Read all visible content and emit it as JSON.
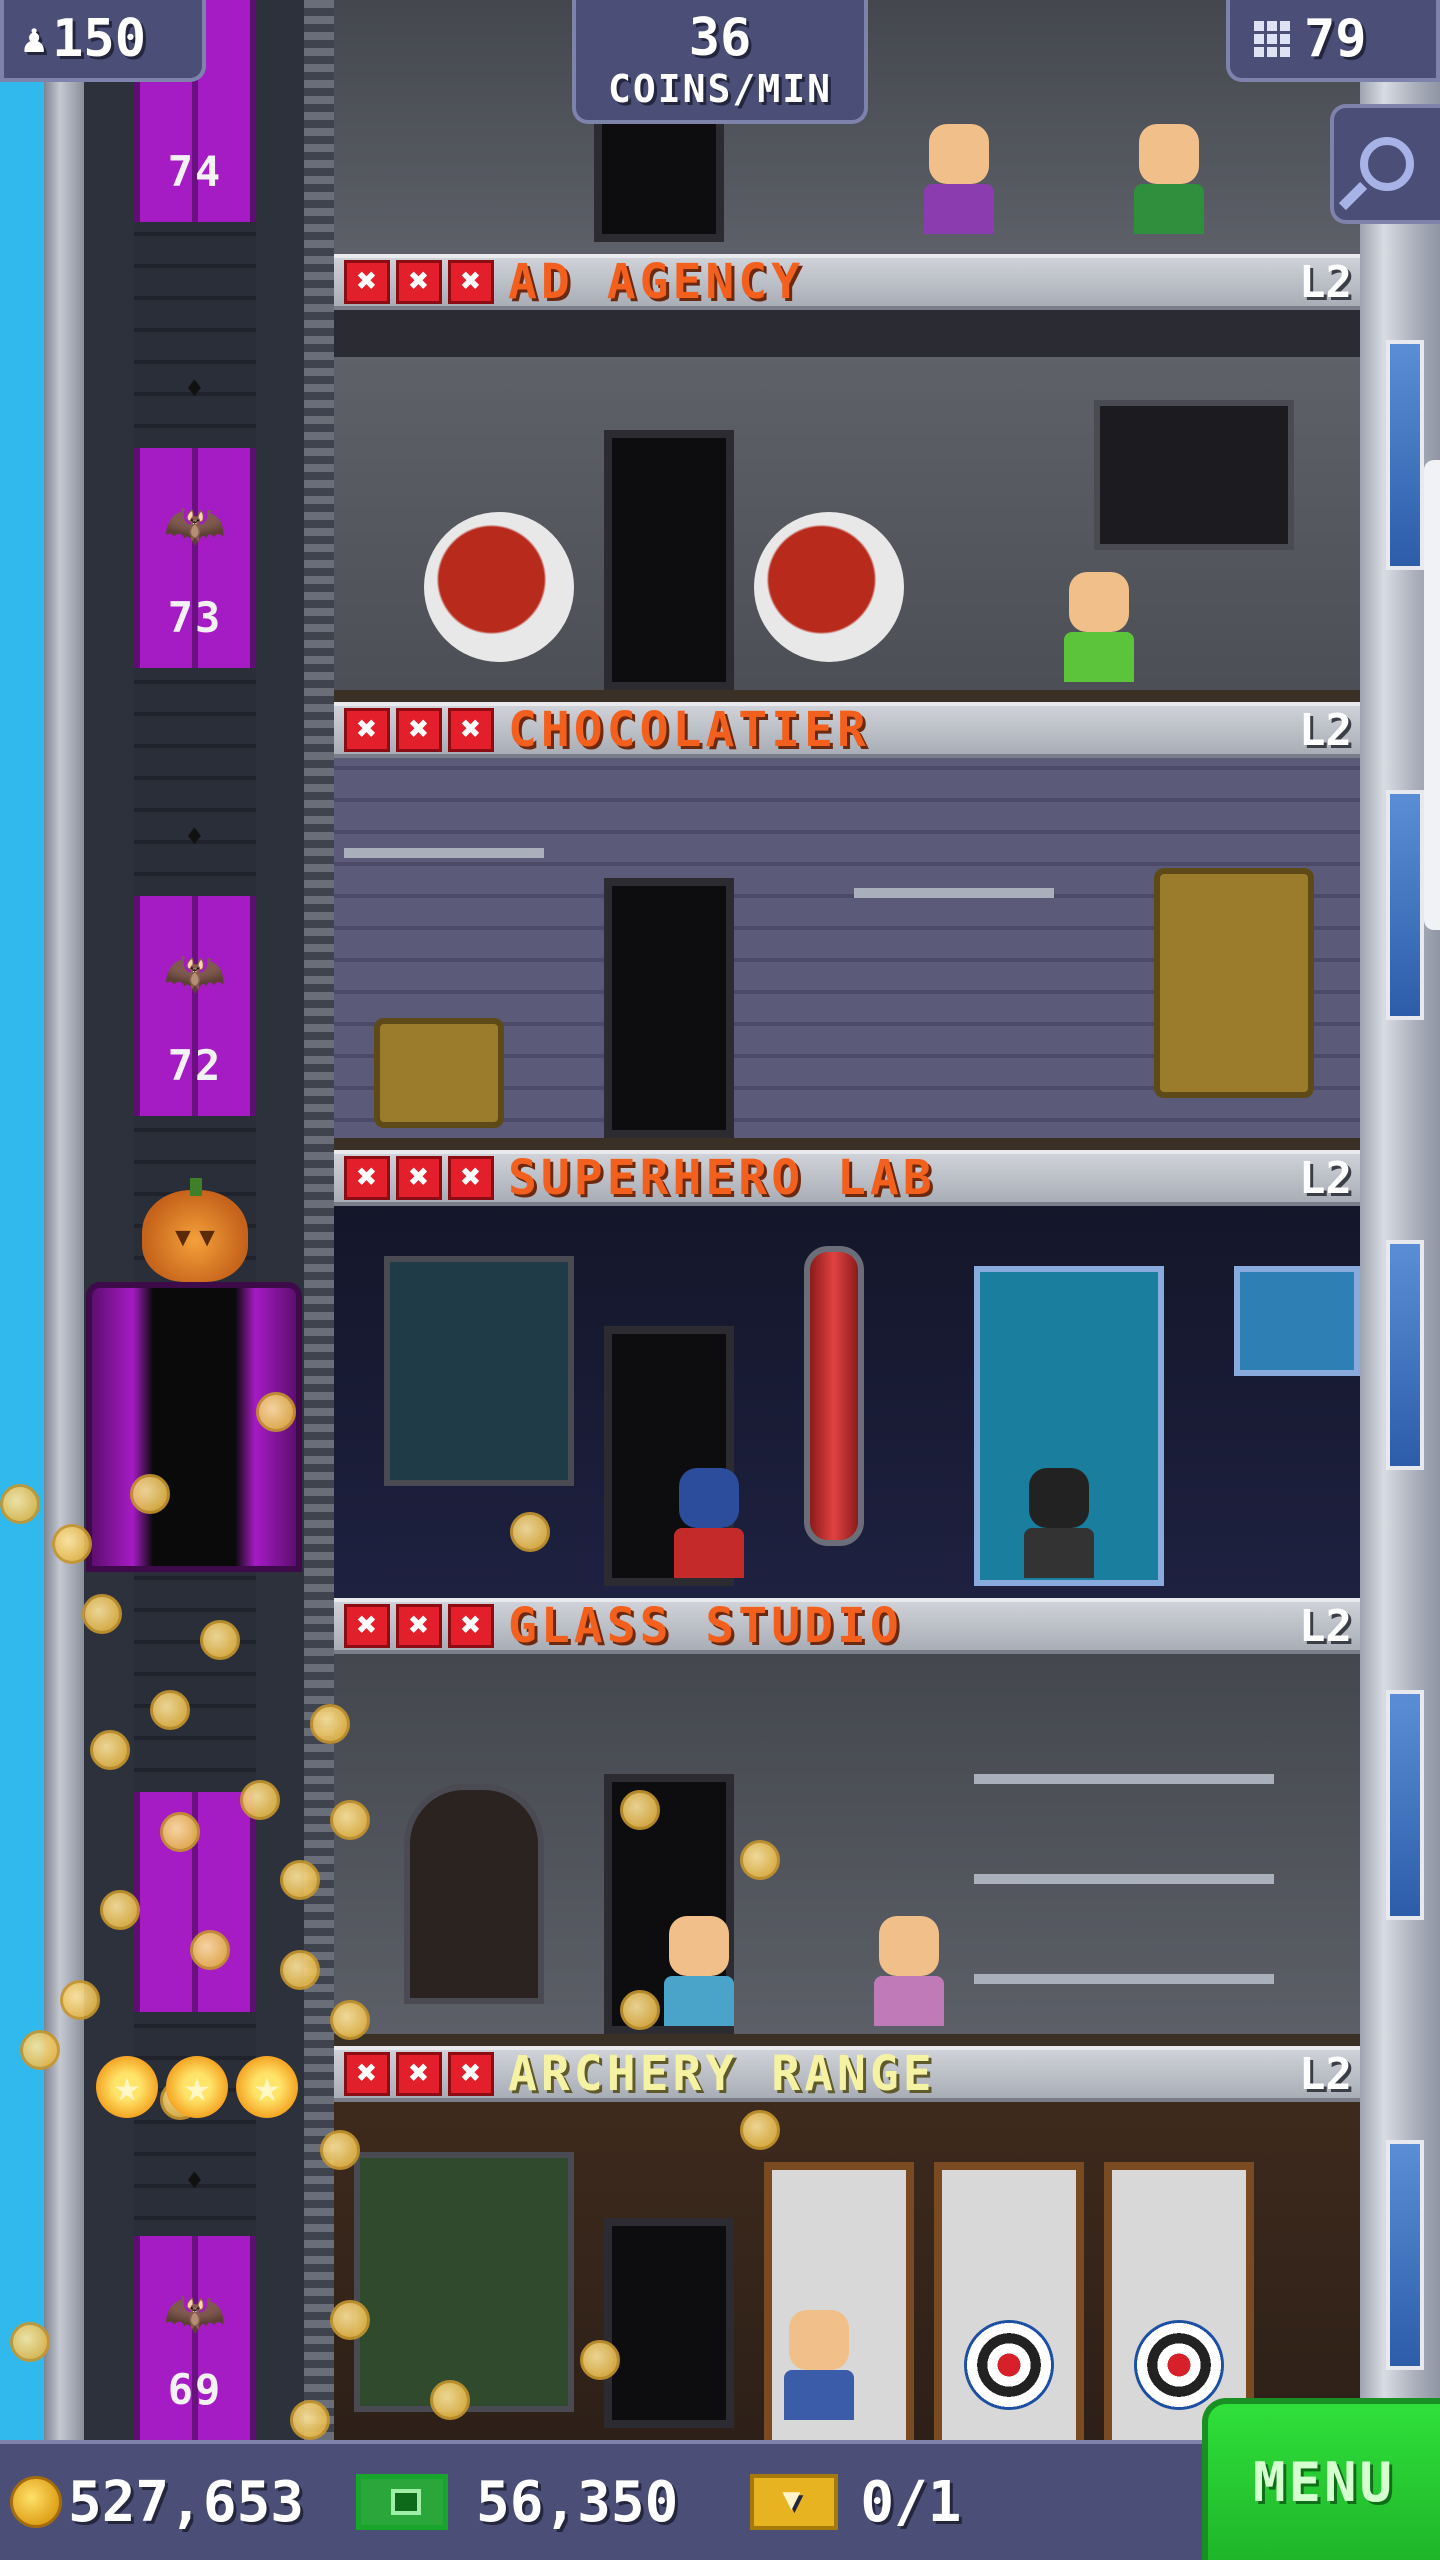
{
  "hud": {
    "population": "150",
    "coins_per_min_value": "36",
    "coins_per_min_unit": "COINS/MIN",
    "floors": "79"
  },
  "elevator": {
    "floors": [
      "74",
      "73",
      "72",
      "69"
    ]
  },
  "floors": [
    {
      "name": "AD AGENCY",
      "level": "L2",
      "stars": [
        "✖",
        "✖",
        "✖"
      ]
    },
    {
      "name": "CHOCOLATIER",
      "level": "L2",
      "stars": [
        "✖",
        "✖",
        "✖"
      ]
    },
    {
      "name": "SUPERHERO LAB",
      "level": "L2",
      "stars": [
        "✖",
        "✖",
        "✖"
      ]
    },
    {
      "name": "GLASS STUDIO",
      "level": "L2",
      "stars": [
        "✖",
        "✖",
        "✖"
      ]
    },
    {
      "name": "ARCHERY RANGE",
      "level": "L2",
      "stars": [
        "✖",
        "✖",
        "✖"
      ]
    }
  ],
  "bottom": {
    "coins": "527,653",
    "bux": "56,350",
    "tickets": "0/1",
    "menu_label": "MENU"
  },
  "icons": {
    "population": "person-icon",
    "floors": "building-icon",
    "zoom": "magnifier-icon",
    "coins": "coin-icon",
    "bux": "bux-icon",
    "tickets": "ticket-icon",
    "bat": "bat-icon",
    "pumpkin": "pumpkin-icon"
  },
  "colors": {
    "sky": "#3ec3f2",
    "hud": "#4b4f77",
    "floor_name": "#f3601e",
    "floor_name_new": "#f6f2a4",
    "star_empty": "#e21f2b",
    "elevator": "#a51bc4",
    "menu": "#2fe03a"
  }
}
